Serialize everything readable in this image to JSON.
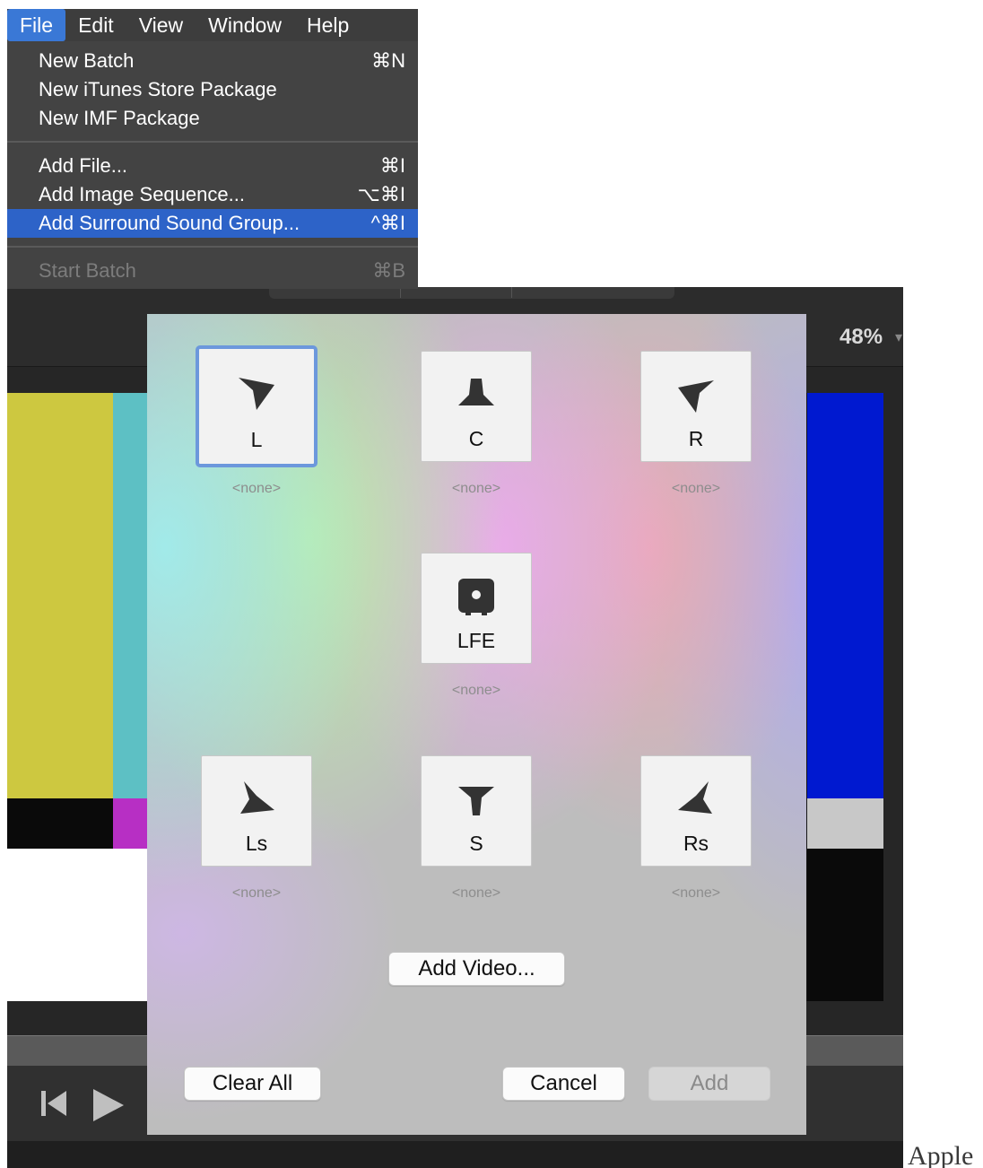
{
  "menu_bar": {
    "items": [
      {
        "label": "File"
      },
      {
        "label": "Edit"
      },
      {
        "label": "View"
      },
      {
        "label": "Window"
      },
      {
        "label": "Help"
      }
    ]
  },
  "file_menu": {
    "items": [
      {
        "label": "New Batch",
        "shortcut": "⌘N"
      },
      {
        "label": "New iTunes Store Package",
        "shortcut": ""
      },
      {
        "label": "New IMF Package",
        "shortcut": ""
      },
      {
        "label": "Add File...",
        "shortcut": "⌘I"
      },
      {
        "label": "Add Image Sequence...",
        "shortcut": "⌥⌘I"
      },
      {
        "label": "Add Surround Sound Group...",
        "shortcut": "^⌘I"
      },
      {
        "label": "Start Batch",
        "shortcut": "⌘B"
      }
    ],
    "highlighted": "Add Surround Sound Group...",
    "disabled": [
      "Start Batch"
    ]
  },
  "viewer": {
    "zoom": "48%",
    "colors": {
      "yellow": "#cdc840",
      "cyan": "#5dc0c4",
      "blue": "#0019d0",
      "magenta": "#b72fc4",
      "grey": "#c8c8c8",
      "black": "#0a0a0a",
      "white": "#ffffff"
    }
  },
  "dialog": {
    "channels": [
      {
        "label": "L",
        "assignment": "<none>",
        "icon": "speaker-front-left-icon",
        "selected": true
      },
      {
        "label": "C",
        "assignment": "<none>",
        "icon": "speaker-center-icon",
        "selected": false
      },
      {
        "label": "R",
        "assignment": "<none>",
        "icon": "speaker-front-right-icon",
        "selected": false
      },
      {
        "label": "LFE",
        "assignment": "<none>",
        "icon": "subwoofer-icon",
        "selected": false
      },
      {
        "label": "Ls",
        "assignment": "<none>",
        "icon": "speaker-left-surround-icon",
        "selected": false
      },
      {
        "label": "S",
        "assignment": "<none>",
        "icon": "speaker-surround-icon",
        "selected": false
      },
      {
        "label": "Rs",
        "assignment": "<none>",
        "icon": "speaker-right-surround-icon",
        "selected": false
      }
    ],
    "add_video_label": "Add Video...",
    "clear_all_label": "Clear All",
    "cancel_label": "Cancel",
    "add_label": "Add"
  },
  "caption": "Apple",
  "colors": {
    "menu_highlight": "#2d63c8",
    "menu_background": "#434343",
    "selection_border": "#6c98dc"
  }
}
